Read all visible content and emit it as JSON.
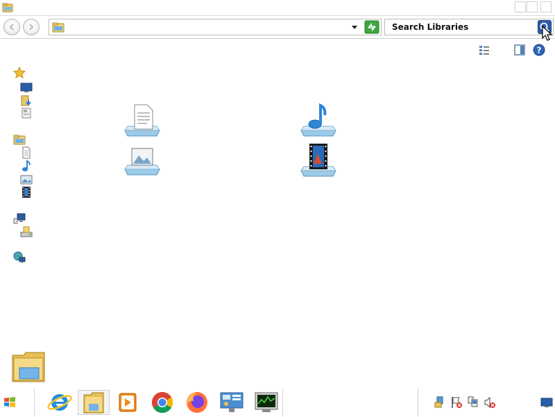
{
  "window": {
    "app_icon": "folder-icon"
  },
  "navigation": {
    "back_icon": "back-arrow-icon",
    "forward_icon": "forward-arrow-icon"
  },
  "address_bar": {
    "value": "",
    "location_icon": "libraries-folder-icon",
    "dropdown_icon": "chevron-down-icon",
    "refresh_icon": "refresh-icon"
  },
  "search": {
    "placeholder": "Search Libraries",
    "icon": "search-icon"
  },
  "toolbar": {
    "view_icon": "change-view-icon",
    "preview_pane_icon": "preview-pane-icon",
    "help_icon": "help-icon"
  },
  "nav_pane": {
    "favorites": [
      "star-icon",
      "desktop-icon",
      "downloads-icon",
      "recent-places-icon"
    ],
    "libraries": [
      "libraries-folder-icon",
      "documents-icon",
      "music-icon",
      "pictures-icon",
      "videos-icon"
    ],
    "computer": [
      "computer-icon",
      "drive-icon"
    ],
    "network": [
      "network-icon"
    ]
  },
  "libraries": [
    {
      "name": "documents-library",
      "icon": "documents-library-icon"
    },
    {
      "name": "music-library",
      "icon": "music-library-icon"
    },
    {
      "name": "pictures-library",
      "icon": "pictures-library-icon"
    },
    {
      "name": "videos-library",
      "icon": "videos-library-icon"
    }
  ],
  "taskbar": {
    "apps": [
      {
        "name": "internet-explorer",
        "icon": "internet-explorer-icon",
        "active": false
      },
      {
        "name": "windows-explorer",
        "icon": "windows-explorer-icon",
        "active": true
      },
      {
        "name": "media-player",
        "icon": "media-player-icon",
        "active": false
      },
      {
        "name": "chrome",
        "icon": "chrome-icon",
        "active": false
      },
      {
        "name": "firefox",
        "icon": "firefox-icon",
        "active": false
      },
      {
        "name": "control-panel",
        "icon": "control-panel-icon",
        "active": false
      },
      {
        "name": "task-manager",
        "icon": "task-manager-icon",
        "active": false
      }
    ],
    "tray": [
      "action-center-icon",
      "flag-icon",
      "network-status-icon",
      "volume-muted-icon",
      "show-desktop-icon"
    ]
  }
}
